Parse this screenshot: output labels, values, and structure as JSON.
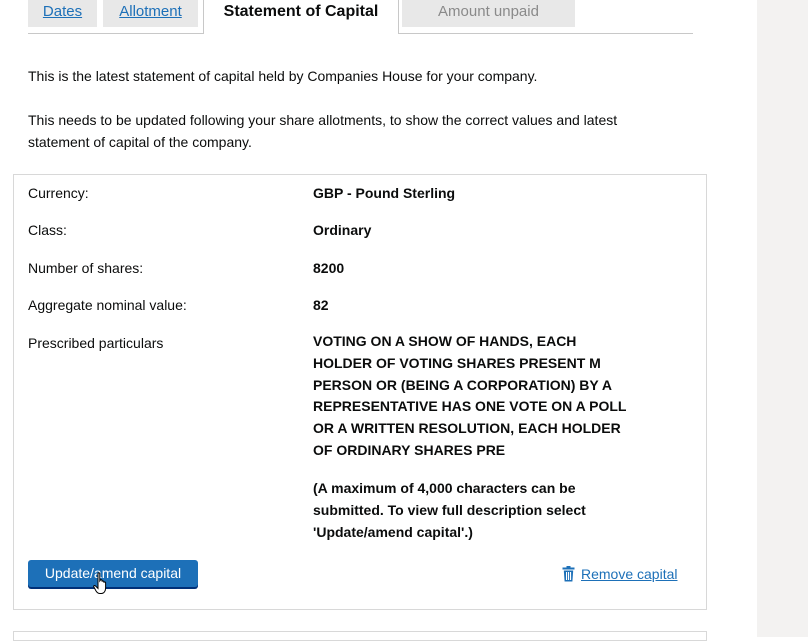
{
  "tabs": [
    {
      "label": "Dates"
    },
    {
      "label": "Allotment"
    },
    {
      "label": "Statement of Capital"
    },
    {
      "label": "Amount unpaid"
    }
  ],
  "intro": {
    "p1": "This is the latest statement of capital held by Companies House for your company.",
    "p2_line1": "This needs to be updated following your share allotments, to show the correct values and latest",
    "p2_line2": "statement of capital of the company."
  },
  "capital": {
    "currency_label": "Currency:",
    "currency_value": "GBP - Pound Sterling",
    "class_label": "Class:",
    "class_value": "Ordinary",
    "shares_label": "Number of shares:",
    "shares_value": "8200",
    "nominal_label": "Aggregate nominal value:",
    "nominal_value": "82",
    "particulars_label": "Prescribed particulars",
    "particulars_lines": [
      "VOTING ON A SHOW OF HANDS, EACH",
      "HOLDER OF VOTING SHARES PRESENT M",
      "PERSON OR (BEING A CORPORATION) BY A",
      "REPRESENTATIVE HAS ONE VOTE ON A POLL",
      "OR A WRITTEN RESOLUTION, EACH HOLDER",
      "OF ORDINARY SHARES PRE"
    ],
    "note_lines": [
      "(A maximum of 4,000 characters can be",
      "submitted. To view full description select",
      "'Update/amend capital'.)"
    ]
  },
  "actions": {
    "update_label": "Update/amend capital",
    "remove_label": "Remove capital",
    "remove_icon": "trash-icon"
  },
  "colors": {
    "link": "#1d70b8",
    "button": "#1d70b8",
    "tab_bg": "#e8e8e8"
  }
}
